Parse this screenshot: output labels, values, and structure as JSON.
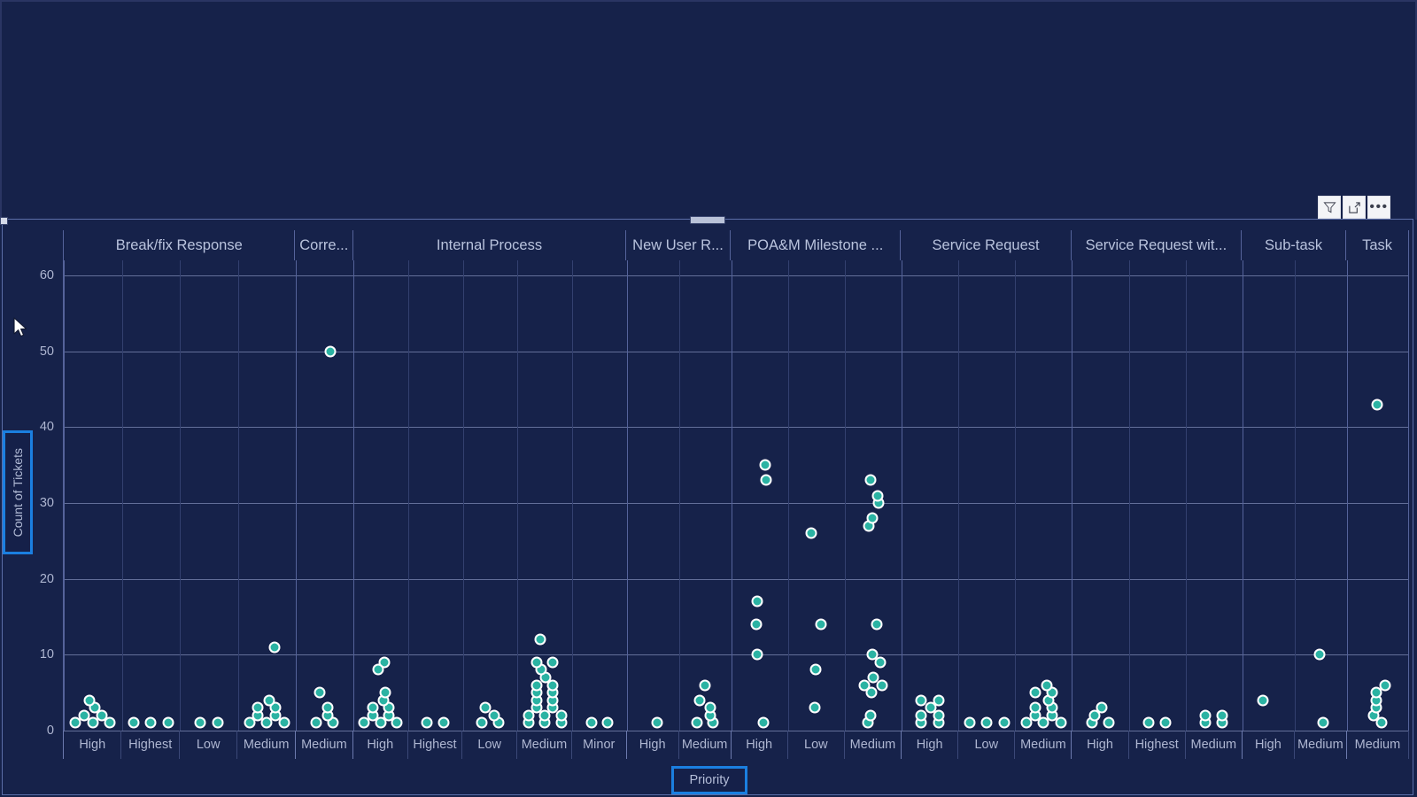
{
  "visual": {
    "header_buttons": [
      {
        "name": "filter-icon",
        "label": "Filters"
      },
      {
        "name": "focus-mode-icon",
        "label": "Focus mode"
      },
      {
        "name": "more-options-icon",
        "label": "More options"
      }
    ]
  },
  "axes": {
    "y_title": "Count of Tickets",
    "x_title": "Priority",
    "y_ticks": [
      0,
      10,
      20,
      30,
      40,
      50,
      60
    ],
    "y_min": 0,
    "y_max": 62
  },
  "chart_data": {
    "type": "scatter",
    "title": "",
    "xlabel": "Priority",
    "ylabel": "Count of Tickets",
    "ylim": [
      0,
      62
    ],
    "grid": true,
    "legend": "none",
    "marker_color": "#2bb3a3",
    "marker_outline": "#ffffff",
    "facet_field": "Request Type",
    "facets": [
      {
        "label": "Break/fix Response",
        "width_frac": 0.1725,
        "categories": [
          {
            "label": "High",
            "values": [
              1,
              1,
              1,
              2,
              2,
              3,
              4
            ]
          },
          {
            "label": "Highest",
            "values": [
              1,
              1,
              1
            ]
          },
          {
            "label": "Low",
            "values": [
              1,
              1
            ]
          },
          {
            "label": "Medium",
            "values": [
              1,
              1,
              1,
              2,
              2,
              3,
              3,
              4,
              11
            ]
          }
        ]
      },
      {
        "label": "Corre...",
        "width_frac": 0.0428,
        "categories": [
          {
            "label": "Medium",
            "values": [
              1,
              1,
              2,
              3,
              5,
              50
            ]
          }
        ]
      },
      {
        "label": "Internal Process",
        "width_frac": 0.2032,
        "categories": [
          {
            "label": "High",
            "values": [
              1,
              1,
              1,
              2,
              2,
              3,
              3,
              4,
              5,
              9,
              8
            ]
          },
          {
            "label": "Highest",
            "values": [
              1,
              1
            ]
          },
          {
            "label": "Low",
            "values": [
              1,
              1,
              2,
              3
            ]
          },
          {
            "label": "Medium",
            "values": [
              1,
              1,
              1,
              2,
              2,
              2,
              3,
              3,
              4,
              4,
              5,
              5,
              6,
              6,
              7,
              8,
              9,
              9,
              12
            ]
          },
          {
            "label": "Minor",
            "values": [
              1,
              1
            ]
          }
        ]
      },
      {
        "label": "New User R...",
        "width_frac": 0.0776,
        "categories": [
          {
            "label": "High",
            "values": [
              1
            ]
          },
          {
            "label": "Medium",
            "values": [
              1,
              1,
              2,
              3,
              4,
              6
            ]
          }
        ]
      },
      {
        "label": "POA&M Milestone ...",
        "width_frac": 0.1267,
        "categories": [
          {
            "label": "High",
            "values": [
              1,
              10,
              14,
              17,
              33,
              35
            ]
          },
          {
            "label": "Low",
            "values": [
              3,
              8,
              14,
              26
            ]
          },
          {
            "label": "Medium",
            "values": [
              1,
              2,
              5,
              6,
              6,
              7,
              9,
              10,
              14,
              27,
              28,
              30,
              31,
              33
            ]
          }
        ]
      },
      {
        "label": "Service Request",
        "width_frac": 0.1267,
        "categories": [
          {
            "label": "High",
            "values": [
              1,
              1,
              2,
              2,
              3,
              4,
              4
            ]
          },
          {
            "label": "Low",
            "values": [
              1,
              1,
              1
            ]
          },
          {
            "label": "Medium",
            "values": [
              1,
              1,
              1,
              2,
              2,
              3,
              3,
              4,
              5,
              5,
              6
            ]
          }
        ]
      },
      {
        "label": "Service Request wit...",
        "width_frac": 0.1267,
        "categories": [
          {
            "label": "High",
            "values": [
              1,
              1,
              2,
              3
            ]
          },
          {
            "label": "Highest",
            "values": [
              1,
              1
            ]
          },
          {
            "label": "Medium",
            "values": [
              1,
              1,
              2,
              2
            ]
          }
        ]
      },
      {
        "label": "Sub-task",
        "width_frac": 0.0776,
        "categories": [
          {
            "label": "High",
            "values": [
              4
            ]
          },
          {
            "label": "Medium",
            "values": [
              1,
              10
            ]
          }
        ]
      },
      {
        "label": "Task",
        "width_frac": 0.0462,
        "categories": [
          {
            "label": "Medium",
            "values": [
              1,
              2,
              3,
              4,
              5,
              6,
              43
            ]
          }
        ]
      }
    ]
  }
}
